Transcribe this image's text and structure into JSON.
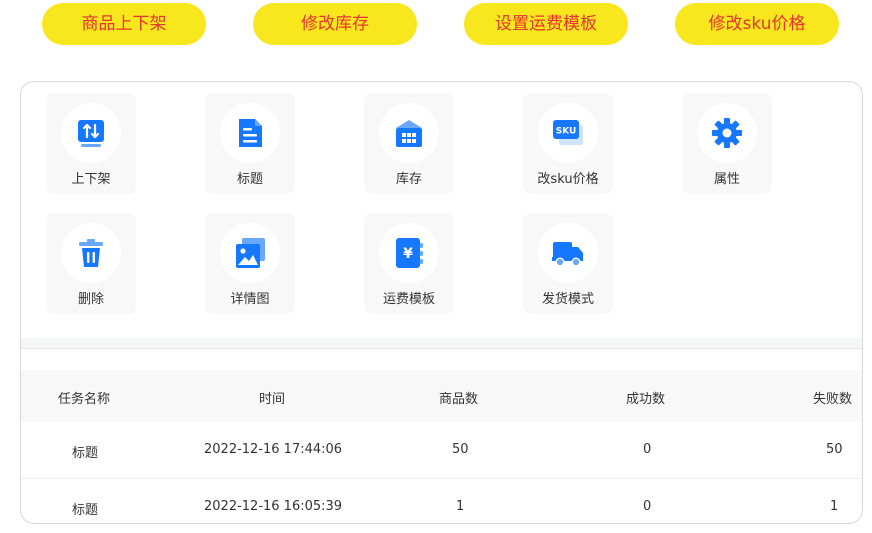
{
  "top_buttons": [
    "商品上下架",
    "修改库存",
    "设置运费模板",
    "修改sku价格"
  ],
  "tools": [
    {
      "label": "上下架",
      "icon": "shelf-updown-icon"
    },
    {
      "label": "标题",
      "icon": "title-doc-icon"
    },
    {
      "label": "库存",
      "icon": "warehouse-icon"
    },
    {
      "label": "改sku价格",
      "icon": "sku-price-icon"
    },
    {
      "label": "属性",
      "icon": "gear-icon"
    },
    {
      "label": "删除",
      "icon": "trash-icon"
    },
    {
      "label": "详情图",
      "icon": "image-icon"
    },
    {
      "label": "运费模板",
      "icon": "freight-yen-icon"
    },
    {
      "label": "发货模式",
      "icon": "truck-icon"
    }
  ],
  "sku_icon_text": "SKU",
  "yen_icon_text": "¥",
  "table": {
    "headers": [
      "任务名称",
      "时间",
      "商品数",
      "成功数",
      "失败数"
    ],
    "rows": [
      [
        "标题",
        "2022-12-16 17:44:06",
        "50",
        "0",
        "50"
      ],
      [
        "标题",
        "2022-12-16 16:05:39",
        "1",
        "0",
        "1"
      ]
    ]
  },
  "colors": {
    "accent_yellow": "#f8e71c",
    "accent_red": "#e8342e",
    "icon_blue": "#1677ff"
  }
}
